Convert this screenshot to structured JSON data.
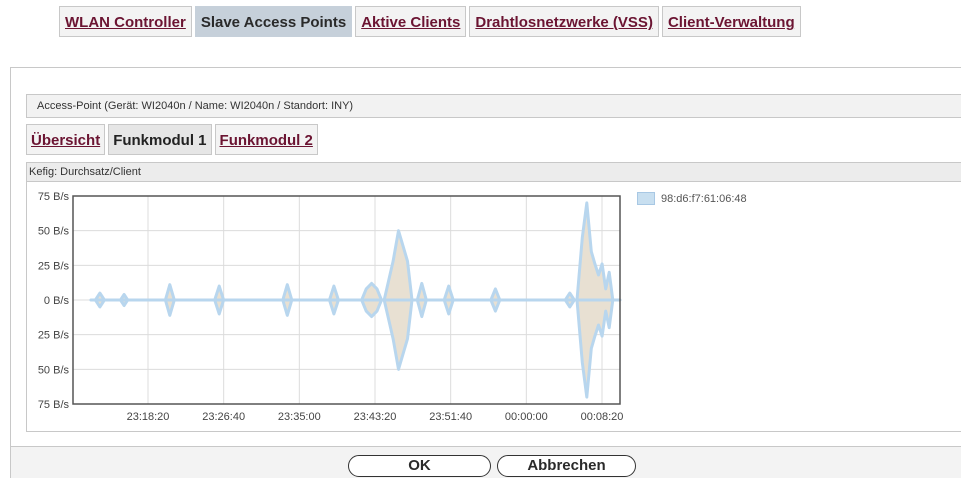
{
  "top_tabs": [
    {
      "label": "WLAN Controller",
      "active": false
    },
    {
      "label": "Slave Access Points",
      "active": true
    },
    {
      "label": "Aktive Clients",
      "active": false
    },
    {
      "label": "Drahtlosnetzwerke (VSS)",
      "active": false
    },
    {
      "label": "Client-Verwaltung",
      "active": false
    }
  ],
  "section": {
    "title": "Access-Point (Gerät: WI2040n / Name: WI2040n / Standort: INY)"
  },
  "sub_tabs": [
    {
      "label": "Übersicht",
      "active": false
    },
    {
      "label": "Funkmodul 1",
      "active": true
    },
    {
      "label": "Funkmodul 2",
      "active": false
    }
  ],
  "chart_header": "Kefig: Durchsatz/Client",
  "buttons": {
    "ok": "OK",
    "cancel": "Abbrechen"
  },
  "chart_data": {
    "type": "area",
    "title": "",
    "xlabel": "",
    "ylabel": "",
    "y_tick_labels": [
      "75 B/s",
      "50 B/s",
      "25 B/s",
      "0 B/s",
      "25 B/s",
      "50 B/s",
      "75 B/s"
    ],
    "y_ticks": [
      75,
      50,
      25,
      0,
      -25,
      -50,
      -75
    ],
    "ylim": [
      -75,
      75
    ],
    "x_tick_labels": [
      "23:18:20",
      "23:26:40",
      "23:35:00",
      "23:43:20",
      "23:51:40",
      "00:00:00",
      "00:08:20"
    ],
    "grid": true,
    "legend_position": "right",
    "series": [
      {
        "name": "98:d6:f7:61:06:48",
        "color": "#b8d6ee",
        "fill": "#e8e0d2",
        "points": [
          [
            2,
            0
          ],
          [
            2.5,
            0
          ],
          [
            3,
            5
          ],
          [
            3.5,
            0
          ],
          [
            5.3,
            0
          ],
          [
            5.7,
            4
          ],
          [
            6.1,
            0
          ],
          [
            10.3,
            0
          ],
          [
            10.8,
            11
          ],
          [
            11.3,
            0
          ],
          [
            15.8,
            0
          ],
          [
            16.3,
            10
          ],
          [
            16.8,
            0
          ],
          [
            23.4,
            0
          ],
          [
            23.9,
            11
          ],
          [
            24.4,
            0
          ],
          [
            28.6,
            0
          ],
          [
            29.1,
            10
          ],
          [
            29.6,
            0
          ],
          [
            32.2,
            0
          ],
          [
            32.7,
            8
          ],
          [
            33.3,
            12
          ],
          [
            33.9,
            8
          ],
          [
            34.4,
            0
          ],
          [
            34.7,
            0
          ],
          [
            35.7,
            28
          ],
          [
            36.3,
            50
          ],
          [
            37.3,
            28
          ],
          [
            37.8,
            0
          ],
          [
            38.4,
            0
          ],
          [
            38.9,
            12
          ],
          [
            39.4,
            0
          ],
          [
            41.4,
            0
          ],
          [
            41.9,
            10
          ],
          [
            42.4,
            0
          ],
          [
            46.6,
            0
          ],
          [
            47.1,
            8
          ],
          [
            47.6,
            0
          ],
          [
            54.9,
            0
          ],
          [
            55.4,
            5
          ],
          [
            55.9,
            0
          ],
          [
            56.2,
            0
          ],
          [
            56.8,
            45
          ],
          [
            57.3,
            70
          ],
          [
            57.8,
            35
          ],
          [
            58.2,
            26
          ],
          [
            58.6,
            18
          ],
          [
            59.0,
            26
          ],
          [
            59.4,
            8
          ],
          [
            59.8,
            20
          ],
          [
            60.2,
            0
          ],
          [
            61,
            0
          ]
        ]
      }
    ]
  }
}
